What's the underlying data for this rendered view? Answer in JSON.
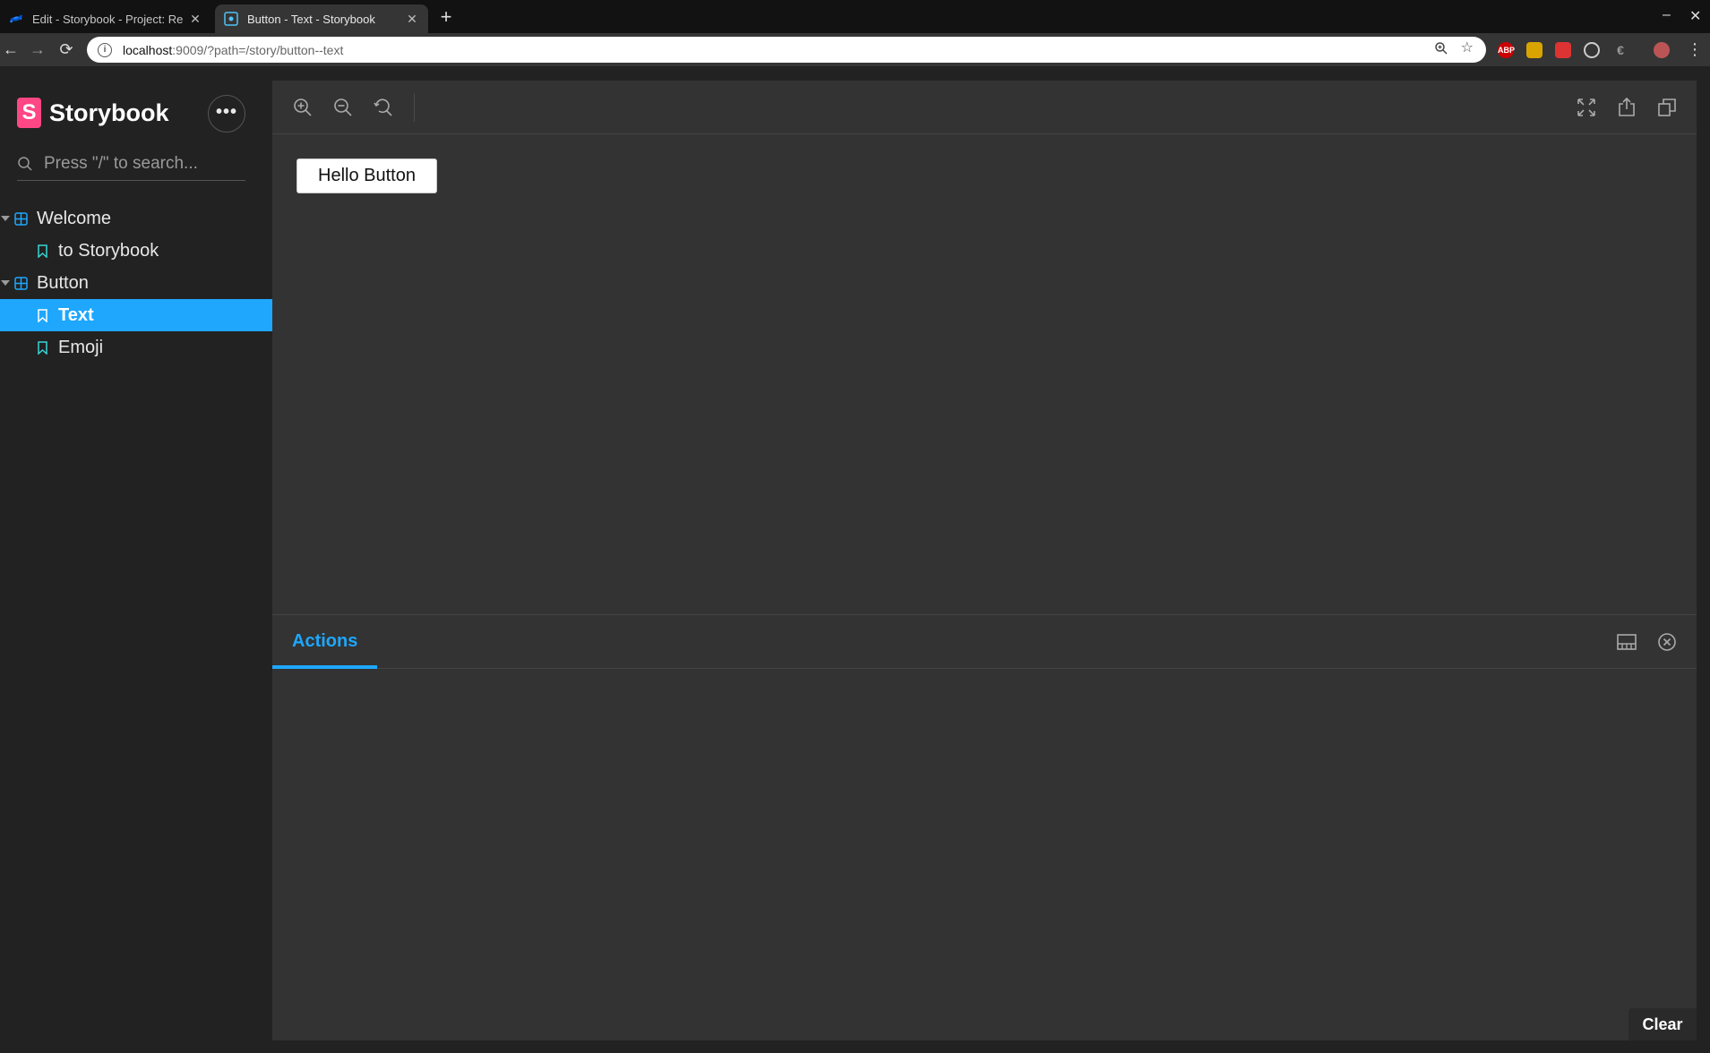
{
  "browser": {
    "tabs": [
      {
        "title": "Edit - Storybook - Project: Re",
        "active": false,
        "favicon": "confluence-icon"
      },
      {
        "title": "Button - Text - Storybook",
        "active": true,
        "favicon": "react-icon"
      }
    ],
    "new_tab": "+",
    "address": {
      "host": "localhost",
      "rest": ":9009/?path=/story/button--text"
    },
    "extensions": [
      "ABP",
      "folder",
      "ext",
      "target",
      "ext",
      "avatar"
    ]
  },
  "sidebar": {
    "brand": "Storybook",
    "logo_letter": "S",
    "menu_label": "•••",
    "search_placeholder": "Press \"/\" to search...",
    "tree": [
      {
        "label": "Welcome",
        "type": "group"
      },
      {
        "label": "to Storybook",
        "type": "story"
      },
      {
        "label": "Button",
        "type": "group"
      },
      {
        "label": "Text",
        "type": "story",
        "selected": true
      },
      {
        "label": "Emoji",
        "type": "story"
      }
    ]
  },
  "canvas": {
    "preview_button": "Hello Button"
  },
  "panel": {
    "tab": "Actions",
    "clear": "Clear"
  },
  "colors": {
    "accent": "#1ea7fd",
    "brand": "#ff4785",
    "background": "#333333",
    "sidebar": "#222222"
  }
}
